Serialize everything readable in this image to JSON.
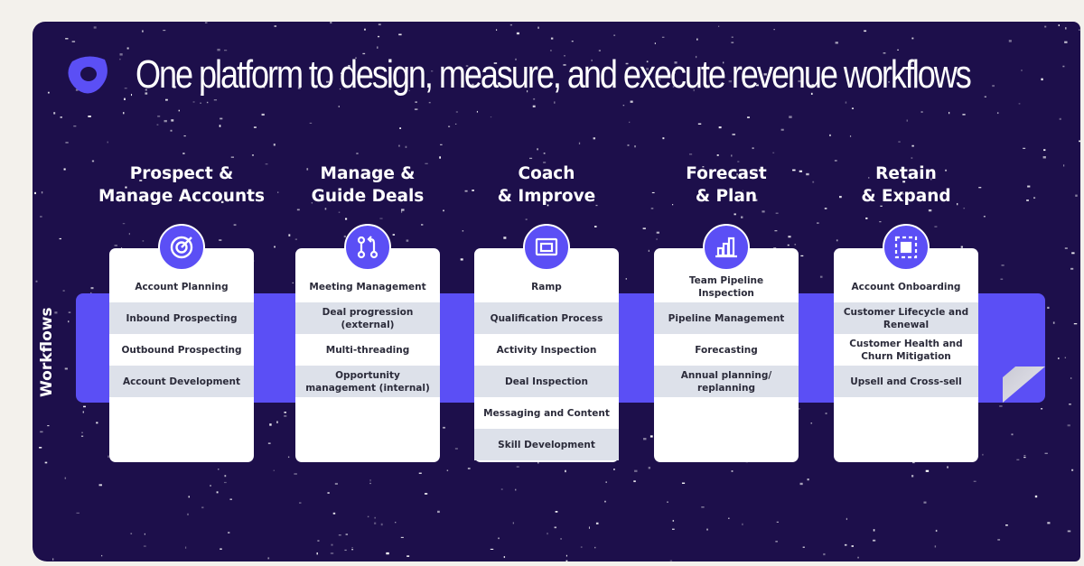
{
  "title": "One platform to design, measure, and execute revenue workflows",
  "band_label": "Workflows",
  "colors": {
    "background": "#1d0f4b",
    "accent": "#5b4ff5",
    "card": "#ffffff",
    "row_alt": "#dde1ea"
  },
  "columns": [
    {
      "heading": [
        "Prospect &",
        "Manage Accounts"
      ],
      "icon": "target-icon",
      "items": [
        "Account Planning",
        "Inbound Prospecting",
        "Outbound Prospecting",
        "Account Development"
      ]
    },
    {
      "heading": [
        "Manage &",
        "Guide Deals"
      ],
      "icon": "git-branch-icon",
      "items": [
        "Meeting Management",
        "Deal progression (external)",
        "Multi-threading",
        "Opportunity management (internal)"
      ]
    },
    {
      "heading": [
        "Coach",
        "& Improve"
      ],
      "icon": "presentation-icon",
      "items": [
        "Ramp",
        "Qualification Process",
        "Activity Inspection",
        "Deal Inspection",
        "Messaging and Content",
        "Skill Development"
      ]
    },
    {
      "heading": [
        "Forecast",
        "& Plan"
      ],
      "icon": "bar-chart-icon",
      "items": [
        "Team Pipeline Inspection",
        "Pipeline Management",
        "Forecasting",
        "Annual planning/ replanning"
      ]
    },
    {
      "heading": [
        "Retain",
        "& Expand"
      ],
      "icon": "frame-icon",
      "items": [
        "Account Onboarding",
        "Customer Lifecycle and Renewal",
        "Customer Health and Churn Mitigation",
        "Upsell and Cross-sell"
      ]
    }
  ]
}
